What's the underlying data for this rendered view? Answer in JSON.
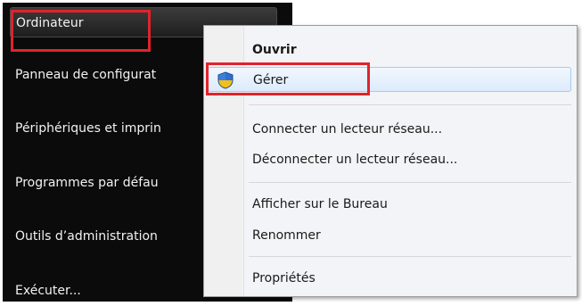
{
  "start_menu": {
    "items": [
      {
        "label": "Ordinateur"
      },
      {
        "label": "Panneau de configurat"
      },
      {
        "label": "Périphériques et imprin"
      },
      {
        "label": "Programmes par défau"
      },
      {
        "label": "Outils d’administration"
      },
      {
        "label": "Exécuter..."
      }
    ]
  },
  "context_menu": {
    "open_label": "Ouvrir",
    "manage_label": "Gérer",
    "map_drive_label": "Connecter un lecteur réseau...",
    "disconnect_drive_label": "Déconnecter un lecteur réseau...",
    "show_desktop_label": "Afficher sur le Bureau",
    "rename_label": "Renommer",
    "properties_label": "Propriétés"
  },
  "colors": {
    "highlight": "#e0232c",
    "start_bg": "#0b0b0b",
    "menu_bg": "#f2f4f7",
    "selected_bg": "#dcebfc"
  },
  "icons": {
    "manage": "uac-shield-icon"
  }
}
